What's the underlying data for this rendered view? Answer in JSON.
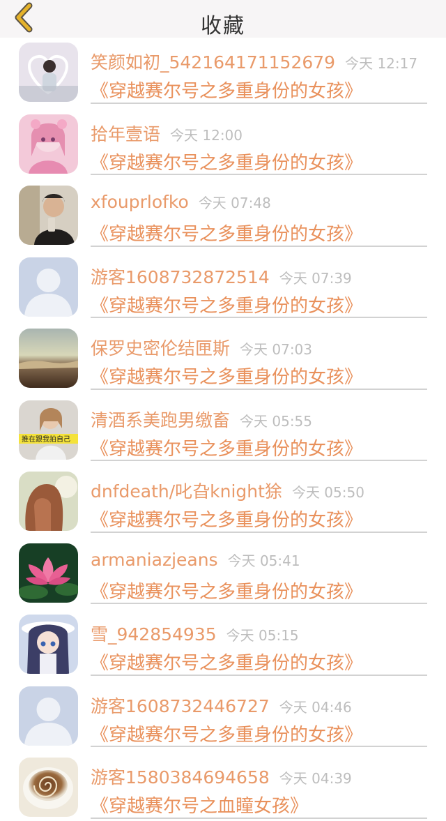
{
  "header": {
    "title": "收藏",
    "back_icon": "chevron-left-icon",
    "back_color": "#e5b22a"
  },
  "colors": {
    "username": "#e99a6a",
    "book": "#e9915c",
    "time": "#bdbdbd"
  },
  "favorites": [
    {
      "user": "笑颜如初_542164171152679",
      "time": "今天 12:17",
      "book": "《穿越赛尔号之多重身份的女孩》",
      "avatar": "photo-girl-heart-frame"
    },
    {
      "user": "拾年壹语",
      "time": "今天 12:00",
      "book": "《穿越赛尔号之多重身份的女孩》",
      "avatar": "anime-girl-pink"
    },
    {
      "user": "xfouprlofko",
      "time": "今天 07:48",
      "book": "《穿越赛尔号之多重身份的女孩》",
      "avatar": "photo-boy-selfie"
    },
    {
      "user": "游客1608732872514",
      "time": "今天 07:39",
      "book": "《穿越赛尔号之多重身份的女孩》",
      "avatar": "default-avatar"
    },
    {
      "user": "保罗史密伦结匣斯",
      "time": "今天 07:03",
      "book": "《穿越赛尔号之多重身份的女孩》",
      "avatar": "landscape-sky"
    },
    {
      "user": "清酒系美跑男缴畜",
      "time": "今天 05:55",
      "book": "《穿越赛尔号之多重身份的女孩》",
      "avatar": "photo-girl-caption"
    },
    {
      "user": "dnfdeath/叱旮knight狳",
      "time": "今天 05:50",
      "book": "《穿越赛尔号之多重身份的女孩》",
      "avatar": "photo-girl-hair"
    },
    {
      "user": "armaniazjeans",
      "time": "今天 05:41",
      "book": "《穿越赛尔号之多重身份的女孩》",
      "avatar": "lotus-flower"
    },
    {
      "user": "雪_942854935",
      "time": "今天 05:15",
      "book": "《穿越赛尔号之多重身份的女孩》",
      "avatar": "anime-girl-hat"
    },
    {
      "user": "游客1608732446727",
      "time": "今天 04:46",
      "book": "《穿越赛尔号之多重身份的女孩》",
      "avatar": "default-avatar"
    },
    {
      "user": "游客1580384694658",
      "time": "今天 04:39",
      "book": "《穿越赛尔号之血瞳女孩》",
      "avatar": "coffee-cup"
    }
  ],
  "avatar_caption": "推在跟我拍自己"
}
